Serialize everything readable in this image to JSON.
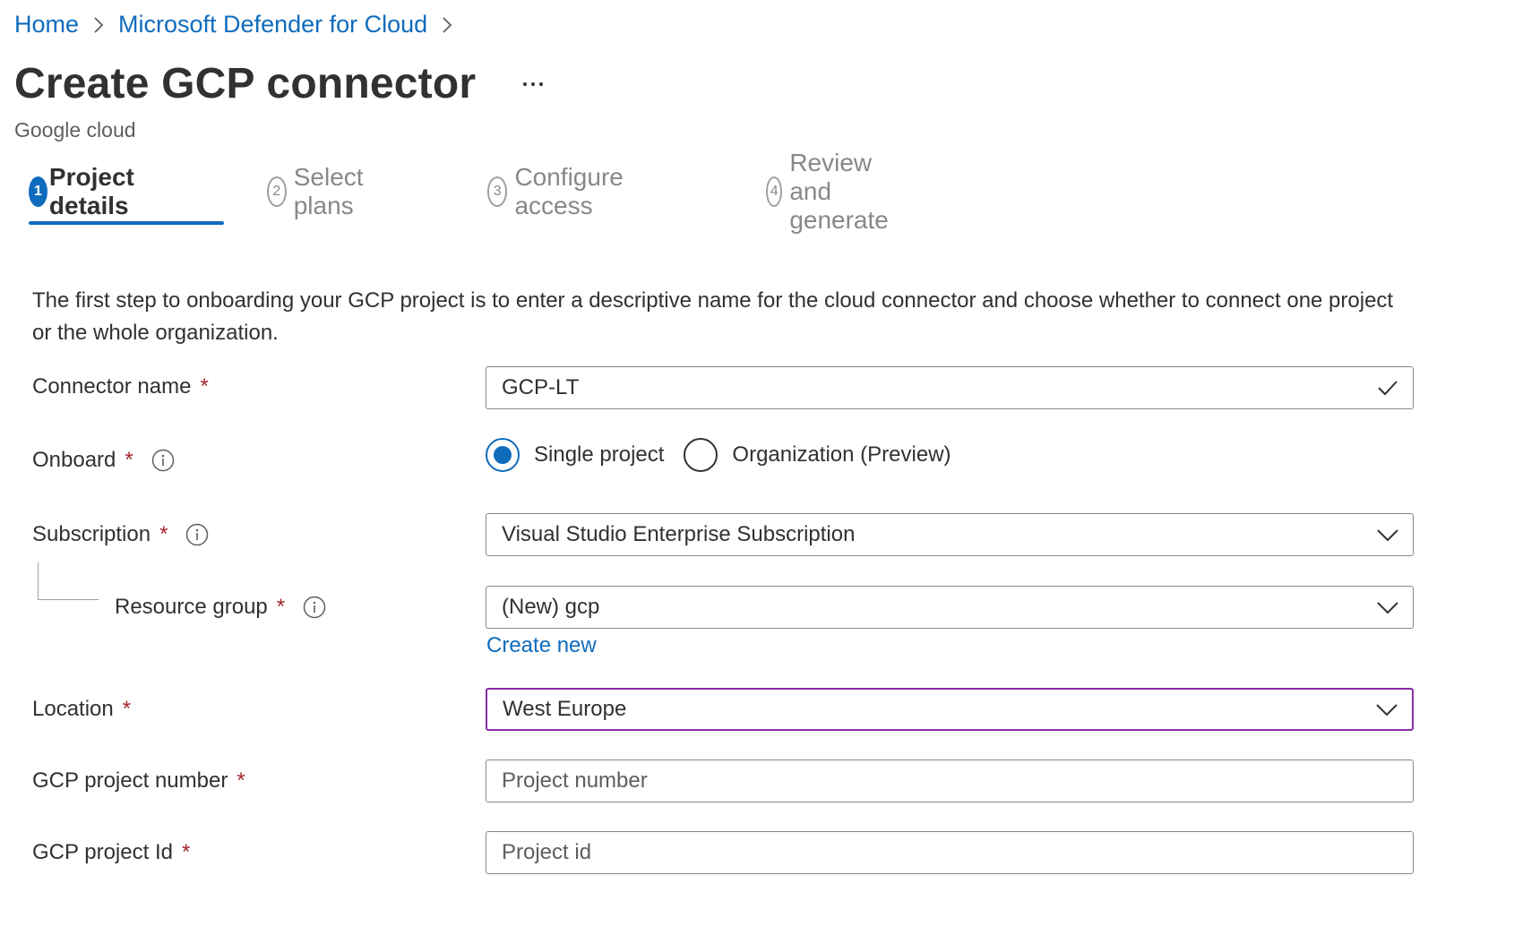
{
  "breadcrumb": {
    "items": [
      "Home",
      "Microsoft Defender for Cloud"
    ]
  },
  "header": {
    "title": "Create GCP connector",
    "more_label": "...",
    "subtitle": "Google cloud"
  },
  "tabs": [
    {
      "num": "1",
      "label": "Project details"
    },
    {
      "num": "2",
      "label": "Select plans"
    },
    {
      "num": "3",
      "label": "Configure access"
    },
    {
      "num": "4",
      "label": "Review and generate"
    }
  ],
  "description": "The first step to onboarding your GCP project is to enter a descriptive name for the cloud connector and choose whether to connect one project or the whole organization.",
  "form": {
    "required_mark": "*",
    "connector_name": {
      "label": "Connector name",
      "value": "GCP-LT"
    },
    "onboard": {
      "label": "Onboard",
      "options": [
        "Single project",
        "Organization (Preview)"
      ],
      "selected": "Single project"
    },
    "subscription": {
      "label": "Subscription",
      "value": "Visual Studio Enterprise Subscription"
    },
    "resource_group": {
      "label": "Resource group",
      "value": "(New) gcp",
      "create_new": "Create new"
    },
    "location": {
      "label": "Location",
      "value": "West Europe"
    },
    "project_number": {
      "label": "GCP project number",
      "placeholder": "Project number"
    },
    "project_id": {
      "label": "GCP project Id",
      "placeholder": "Project id"
    }
  },
  "colors": {
    "accent": "#0f6cbd",
    "required": "#a4262c",
    "focus_border": "#8a2da5"
  },
  "icons": [
    "chevron-right-icon",
    "more-icon",
    "info-icon",
    "checkmark-icon",
    "chevron-down-icon"
  ]
}
